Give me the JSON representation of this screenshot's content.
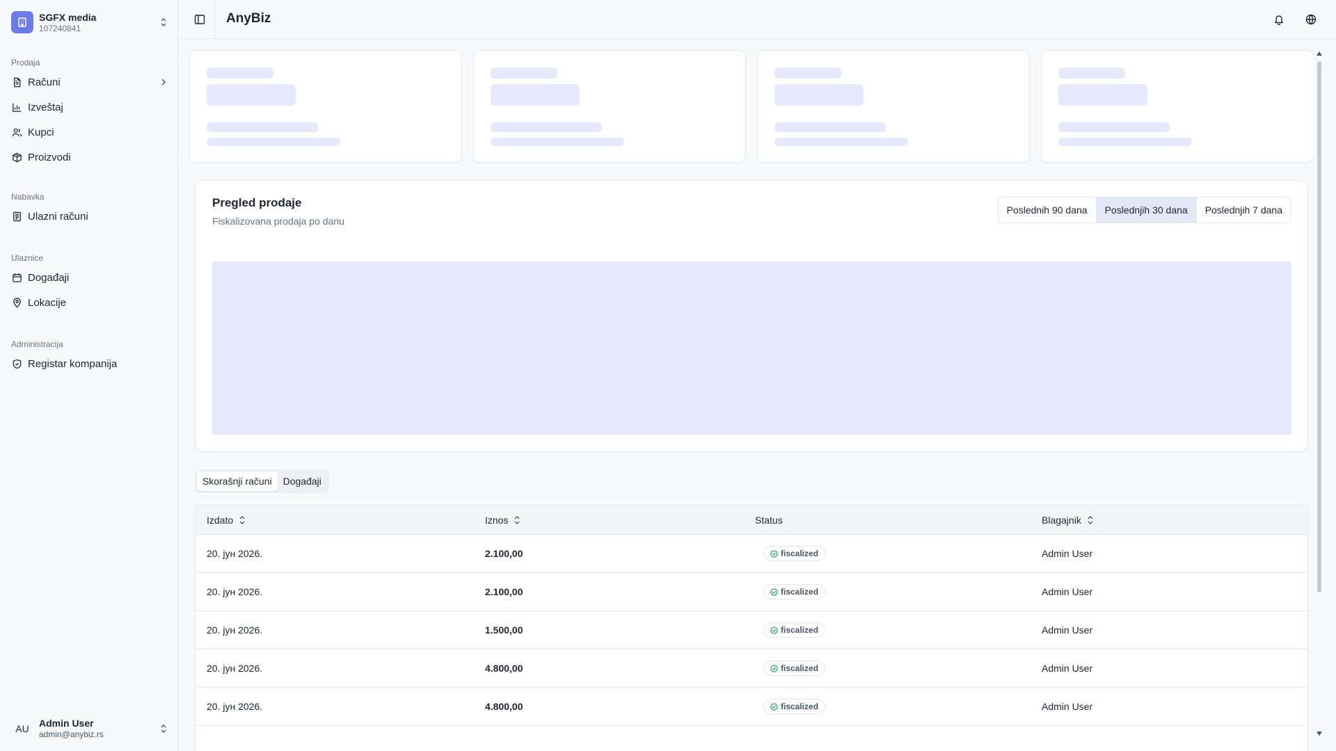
{
  "company": {
    "name": "SGFX media",
    "id": "107240841"
  },
  "sidebar": {
    "groups": [
      {
        "heading": "Prodaja",
        "items": [
          {
            "label": "Računi",
            "icon": "file-text-icon"
          },
          {
            "label": "Izveštaj",
            "icon": "bar-chart-icon"
          },
          {
            "label": "Kupci",
            "icon": "users-icon"
          },
          {
            "label": "Proizvodi",
            "icon": "package-icon"
          }
        ]
      },
      {
        "heading": "Nabavka",
        "items": [
          {
            "label": "Ulazni računi",
            "icon": "receipt-icon"
          }
        ]
      },
      {
        "heading": "Ulaznice",
        "items": [
          {
            "label": "Događaji",
            "icon": "calendar-icon"
          },
          {
            "label": "Lokacije",
            "icon": "map-pin-icon"
          }
        ]
      },
      {
        "heading": "Administracija",
        "items": [
          {
            "label": "Registar kompanija",
            "icon": "shield-icon"
          }
        ]
      }
    ]
  },
  "user": {
    "initials": "AU",
    "name": "Admin User",
    "email": "admin@anybiz.rs"
  },
  "header": {
    "title": "AnyBiz"
  },
  "sales": {
    "title": "Pregled prodaje",
    "subtitle": "Fiskalizovana prodaja po danu",
    "ranges": [
      "Poslednih 90 dana",
      "Poslednjih 30 dana",
      "Poslednjih 7 dana"
    ],
    "active_range": "Poslednjih 30 dana"
  },
  "tabs": [
    "Skorašnji računi",
    "Događaji"
  ],
  "active_tab": "Skorašnji računi",
  "table": {
    "columns": [
      "Izdato",
      "Iznos",
      "Status",
      "Blagajnik"
    ],
    "rows": [
      {
        "date": "20. јун 2026.",
        "amount": "2.100,00",
        "status": "fiscalized",
        "cashier": "Admin User"
      },
      {
        "date": "20. јун 2026.",
        "amount": "2.100,00",
        "status": "fiscalized",
        "cashier": "Admin User"
      },
      {
        "date": "20. јун 2026.",
        "amount": "1.500,00",
        "status": "fiscalized",
        "cashier": "Admin User"
      },
      {
        "date": "20. јун 2026.",
        "amount": "4.800,00",
        "status": "fiscalized",
        "cashier": "Admin User"
      },
      {
        "date": "20. јун 2026.",
        "amount": "4.800,00",
        "status": "fiscalized",
        "cashier": "Admin User"
      }
    ]
  },
  "colors": {
    "accent": "#6d7be6",
    "skeleton": "#e5e9fb",
    "active_range_bg": "#e3e8f7",
    "success": "#16a34a"
  }
}
